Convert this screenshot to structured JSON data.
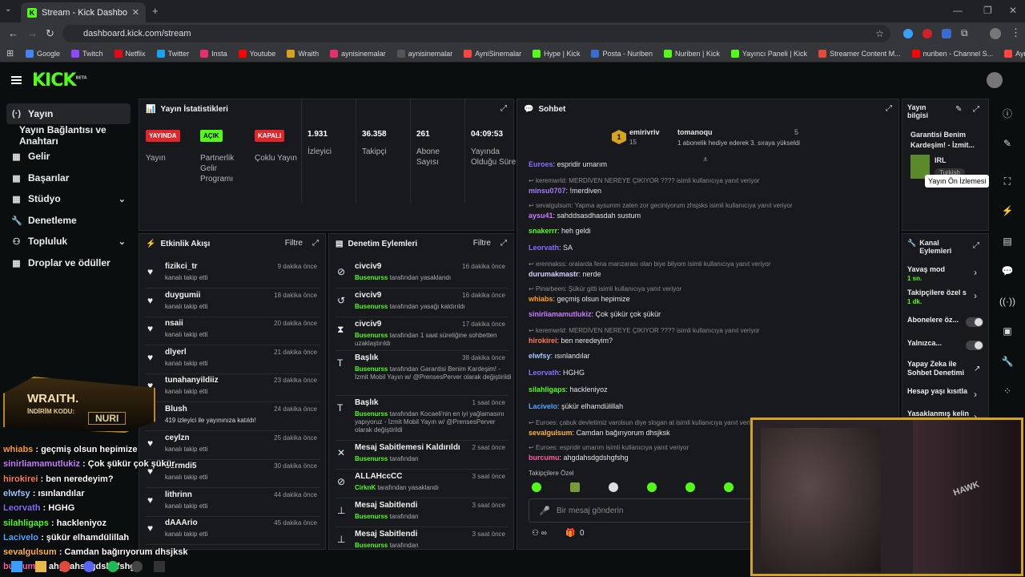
{
  "browser": {
    "tab_title": "Stream - Kick Dashboard",
    "url": "dashboard.kick.com/stream",
    "bookmarks": [
      "Google",
      "Twitch",
      "Netflix",
      "Twitter",
      "Insta",
      "Youtube",
      "Wraith",
      "aynisinemalar",
      "aynisinemalar",
      "AyniSinemalar",
      "Hype | Kick",
      "Posta - Nuriben",
      "Nuriben | Kick",
      "Yayıncı Paneli | Kick",
      "Streamer Content M...",
      "nuriben - Channel S...",
      "Aynı Sinemalar - Ça..."
    ]
  },
  "app": {
    "logo": "KICK",
    "logo_sup": "BETA"
  },
  "sidebar": {
    "items": [
      {
        "label": "Yayın",
        "icon": "broadcast-icon"
      },
      {
        "label": "Yayın Bağlantısı ve Anahtarı",
        "icon": ""
      },
      {
        "label": "Gelir",
        "icon": "revenue-icon"
      },
      {
        "label": "Başarılar",
        "icon": "achievements-icon"
      },
      {
        "label": "Stüdyo",
        "icon": "studio-icon"
      },
      {
        "label": "Denetleme",
        "icon": "wrench-icon"
      },
      {
        "label": "Topluluk",
        "icon": "community-icon"
      },
      {
        "label": "Droplar ve ödüller",
        "icon": "gift-icon"
      }
    ]
  },
  "stats": {
    "title": "Yayın İstatistikleri",
    "items": [
      {
        "badge": "YAYINDA",
        "badge_color": "#e0262b",
        "label": "Yayın"
      },
      {
        "badge": "AÇIK",
        "badge_color": "#53fc18",
        "label": "Partnerlik Gelir Programı"
      },
      {
        "badge": "KAPALI",
        "badge_color": "#e0262b",
        "label": "Çoklu Yayın"
      },
      {
        "value": "1.931",
        "label": "İzleyici"
      },
      {
        "value": "36.358",
        "label": "Takipçi"
      },
      {
        "value": "261",
        "label": "Abone Sayısı"
      },
      {
        "value": "04:09:53",
        "label": "Yayında Olduğu Süre"
      }
    ]
  },
  "activity": {
    "title": "Etkinlik Akışı",
    "filter": "Filtre",
    "rows": [
      {
        "name": "fizikci_tr",
        "time": "9 dakika önce",
        "sub": "kanalı takip etti"
      },
      {
        "name": "duygumii",
        "time": "18 dakika önce",
        "sub": "kanalı takip etti"
      },
      {
        "name": "nsaii",
        "time": "20 dakika önce",
        "sub": "kanalı takip etti"
      },
      {
        "name": "dlyerl",
        "time": "21 dakika önce",
        "sub": "kanalı takip etti"
      },
      {
        "name": "tunahanyildiiz",
        "time": "23 dakika önce",
        "sub": "kanalı takip etti"
      },
      {
        "name": "Blush",
        "time": "24 dakika önce",
        "sub": "419 izleyici ile yayınınıza katıldı!"
      },
      {
        "name": "ceylzn",
        "time": "25 dakika önce",
        "sub": "kanalı takip etti"
      },
      {
        "name": "durmdi5",
        "time": "30 dakika önce",
        "sub": "kanalı takip etti"
      },
      {
        "name": "lithrinn",
        "time": "44 dakika önce",
        "sub": "kanalı takip etti"
      },
      {
        "name": "dAAArio",
        "time": "45 dakika önce",
        "sub": "kanalı takip etti"
      }
    ]
  },
  "moderation": {
    "title": "Denetim Eylemleri",
    "filter": "Filtre",
    "rows": [
      {
        "name": "civciv9",
        "time": "16 dakika önce",
        "actor": "Busenurss",
        "sub": " tarafından yasaklandı"
      },
      {
        "name": "civciv9",
        "time": "16 dakika önce",
        "actor": "Busenurss",
        "sub": " tarafından yasağı kaldırıldı"
      },
      {
        "name": "civciv9",
        "time": "17 dakika önce",
        "actor": "Busenurss",
        "sub": " tarafından 1 saat süreliğine sohbetten uzaklaştırıldı"
      },
      {
        "name": "Başlık",
        "time": "38 dakika önce",
        "actor": "Busenurss",
        "sub": " tarafından Garantisi Benim Kardeşim! - İzmit Mobil Yayın w/ @PrensesPerver olarak değiştirildi"
      },
      {
        "name": "Başlık",
        "time": "1 saat önce",
        "actor": "Busenurss",
        "sub": " tarafından Kocaeli'nin en iyi yağlamasını yapıyoruz - İzmit Mobil Yayın w/ @PrensesPerver olarak değiştirildi"
      },
      {
        "name": "Mesaj Sabitlemesi Kaldırıldı",
        "time": "2 saat önce",
        "actor": "Busenurss",
        "sub": " tarafından"
      },
      {
        "name": "ALLAHccCC",
        "time": "3 saat önce",
        "actor": "CirknK",
        "sub": " tarafından yasaklandı"
      },
      {
        "name": "Mesaj Sabitlendi",
        "time": "3 saat önce",
        "actor": "Busenurss",
        "sub": " tarafından"
      },
      {
        "name": "Mesaj Sabitlendi",
        "time": "3 saat önce",
        "actor": "Busenurss",
        "sub": " tarafından"
      }
    ]
  },
  "chat": {
    "title": "Sohbet",
    "pinned": {
      "user1": "emirivriv",
      "count1": "15",
      "user2": "tomanoqu",
      "count2": "5",
      "text": "1 abonelik hediye ederek 3. sıraya yükseldi"
    },
    "lines": [
      {
        "reply": "",
        "user": "Euroes",
        "color": "#8a6cff",
        "msg": "espridir umarım"
      },
      {
        "reply": "keremwrld: MERDİVEN NEREYE ÇIKIYOR ???? isimli kullanıcıya yanıt veriyor",
        "user": "minsu0707",
        "color": "#a77bff",
        "msg": "!merdiven"
      },
      {
        "reply": "sevalgulsum: Yapma aysumm zaten zor geciniyorum zhsjsks isimli kullanıcıya yanıt veriyor",
        "user": "aysu41",
        "color": "#c77dff",
        "msg": "sahddsasdhasdah sustum"
      },
      {
        "reply": "",
        "user": "snakerrr",
        "color": "#53fc18",
        "msg": "heh geldi"
      },
      {
        "reply": "",
        "user": "Leorvath",
        "color": "#8a6cff",
        "msg": "SA"
      },
      {
        "reply": "erennakss: oralarda fena manzarası olan biye bilyom isimli kullanıcıya yanıt veriyor",
        "user": "durumakmastr",
        "color": "#d0d0ff",
        "msg": "nerde"
      },
      {
        "reply": "Pinarbeen: Şükür gitti isimli kullanıcıya yanıt veriyor",
        "user": "whiabs",
        "color": "#ff9f1c",
        "msg": "geçmiş olsun hepimize"
      },
      {
        "reply": "",
        "user": "sinirliamamutlukiz",
        "color": "#c77dff",
        "msg": "Çok şükür çok şükür"
      },
      {
        "reply": "keremwrld: MERDİVEN NEREYE ÇIKIYOR ???? isimli kullanıcıya yanıt veriyor",
        "user": "hirokirei",
        "color": "#ff7a59",
        "msg": "ben neredeyim?"
      },
      {
        "reply": "",
        "user": "elwfsy",
        "color": "#9cc7ff",
        "msg": "ısınlandılar"
      },
      {
        "reply": "",
        "user": "Leorvath",
        "color": "#8a6cff",
        "msg": "HGHG"
      },
      {
        "reply": "",
        "user": "silahligaps",
        "color": "#53fc18",
        "msg": "hackleniyoz"
      },
      {
        "reply": "",
        "user": "Lacivelo",
        "color": "#4da6ff",
        "msg": "şükür elhamdülillah"
      },
      {
        "reply": "Euroes: çabuk devletimiz varolsun diye slogan at isimli kullanıcıya yanıt veriyor",
        "user": "sevalgulsum",
        "color": "#ffb347",
        "msg": "Camdan bağırıyorum dhsjksk"
      },
      {
        "reply": "Euroes: espridir umarım isimli kullanıcıya yanıt veriyor",
        "user": "burcumu",
        "color": "#ff5ca8",
        "msg": "ahgdahsdgdshgfshg"
      }
    ],
    "followers_only": "Takipçilere Özel",
    "input_placeholder": "Bir mesaj gönderin",
    "footer_count": "0"
  },
  "stream_info": {
    "title": "Yayın bilgisi",
    "stream_title": "Garantisi Benim Kardeşim! - İzmit...",
    "category": "IRL",
    "language": "Turkish",
    "tooltip": "Yayın Ön İzlemesi"
  },
  "channel_actions": {
    "title": "Kanal Eylemleri",
    "items": [
      {
        "label": "Yavaş mod",
        "value": "1 sn."
      },
      {
        "label": "Takipçilere özel s",
        "value": "1 dk."
      },
      {
        "label": "Abonelere öz...",
        "value": ""
      },
      {
        "label": "Yalnızca...",
        "value": ""
      },
      {
        "label": "Yapay Zeka ile Sohbet Denetimi",
        "value": ""
      },
      {
        "label": "Hesap yaşı kısıtla",
        "value": ""
      },
      {
        "label": "Yasaklanmış kelin",
        "value": ""
      }
    ]
  },
  "overlay": {
    "brand": "WRAITH.",
    "code_label": "İNDİRİM KODU:",
    "code": "NURI",
    "lines": [
      {
        "user": "whiabs",
        "color": "#ff9f1c",
        "msg": " : geçmiş olsun hepimize"
      },
      {
        "user": "sinirliamamutlukiz",
        "color": "#c77dff",
        "msg": " : Çok şükür çok şükür"
      },
      {
        "user": "hirokirei",
        "color": "#ff7a59",
        "msg": " : ben neredeyim?"
      },
      {
        "user": "elwfsy",
        "color": "#9cc7ff",
        "msg": " : ısınlandılar"
      },
      {
        "user": "Leorvath",
        "color": "#8a6cff",
        "msg": " : HGHG"
      },
      {
        "user": "silahligaps",
        "color": "#53fc18",
        "msg": " : hackleniyoz"
      },
      {
        "user": "Lacivelo",
        "color": "#4da6ff",
        "msg": " : şükür elhamdülillah"
      },
      {
        "user": "sevalgulsum",
        "color": "#ffb347",
        "msg": " : Camdan bağırıyorum dhsjksk"
      },
      {
        "user": "burcumu",
        "color": "#ff5ca8",
        "msg": " : ahgdahsdgdshgfshg"
      }
    ]
  }
}
